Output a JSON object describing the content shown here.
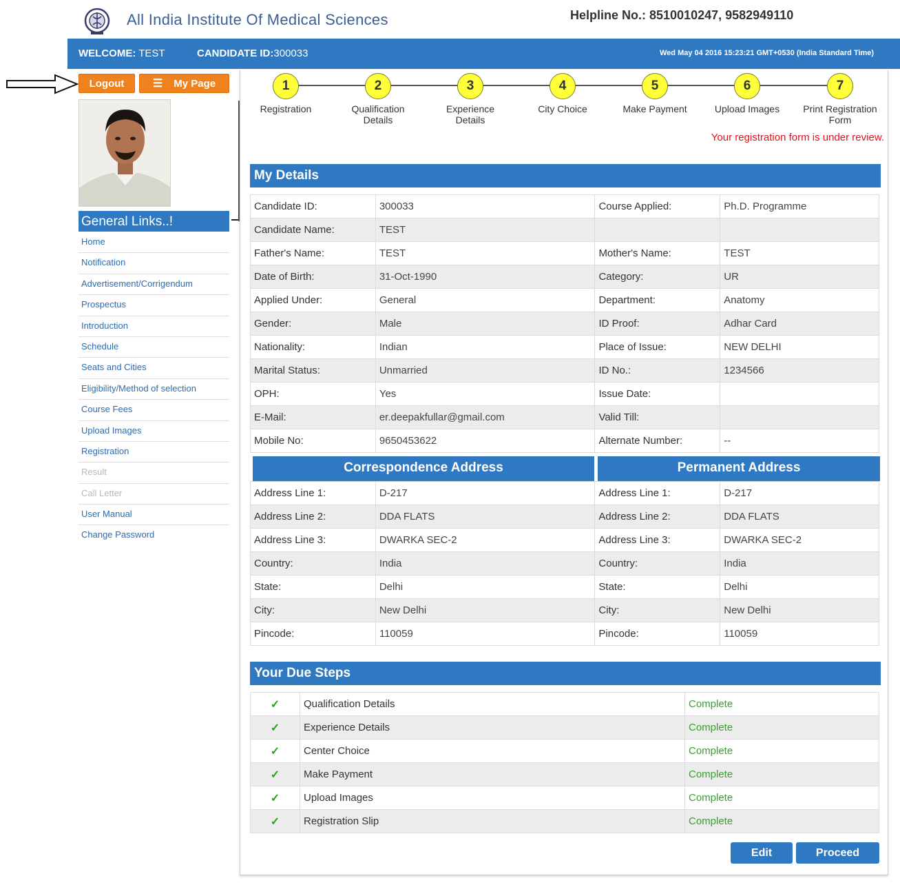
{
  "header": {
    "institute_name": "All India Institute Of Medical Sciences",
    "helpline": "Helpline No.: 8510010247, 9582949110"
  },
  "welcome_bar": {
    "welcome_label": "WELCOME:",
    "welcome_value": "TEST",
    "candidate_label": "CANDIDATE ID:",
    "candidate_value": "300033",
    "datetime": "Wed May 04 2016 15:23:21 GMT+0530 (India Standard Time)"
  },
  "sidebar": {
    "logout_label": "Logout",
    "mypage_label": "My Page",
    "general_links_title": "General Links..!",
    "links": [
      {
        "label": "Home",
        "enabled": true
      },
      {
        "label": "Notification",
        "enabled": true
      },
      {
        "label": "Advertisement/Corrigendum",
        "enabled": true
      },
      {
        "label": "Prospectus",
        "enabled": true
      },
      {
        "label": "Introduction",
        "enabled": true
      },
      {
        "label": "Schedule",
        "enabled": true
      },
      {
        "label": "Seats and Cities",
        "enabled": true
      },
      {
        "label": "Eligibility/Method of selection",
        "enabled": true
      },
      {
        "label": "Course Fees",
        "enabled": true
      },
      {
        "label": "Upload Images",
        "enabled": true
      },
      {
        "label": "Registration",
        "enabled": true
      },
      {
        "label": "Result",
        "enabled": false
      },
      {
        "label": "Call Letter",
        "enabled": false
      },
      {
        "label": "User Manual",
        "enabled": true
      },
      {
        "label": "Change Password",
        "enabled": true
      }
    ]
  },
  "stepper": {
    "steps": [
      {
        "num": "1",
        "label1": "Registration",
        "label2": ""
      },
      {
        "num": "2",
        "label1": "Qualification",
        "label2": "Details"
      },
      {
        "num": "3",
        "label1": "Experience",
        "label2": "Details"
      },
      {
        "num": "4",
        "label1": "City Choice",
        "label2": ""
      },
      {
        "num": "5",
        "label1": "Make Payment",
        "label2": ""
      },
      {
        "num": "6",
        "label1": "Upload Images",
        "label2": ""
      },
      {
        "num": "7",
        "label1": "Print Registration",
        "label2": "Form"
      }
    ],
    "review_notice": "Your registration form is under review."
  },
  "my_details": {
    "title": "My Details",
    "rows": [
      [
        "Candidate ID:",
        "300033",
        "Course Applied:",
        "Ph.D. Programme"
      ],
      [
        "Candidate Name:",
        "TEST",
        "",
        ""
      ],
      [
        "Father's Name:",
        "TEST",
        "Mother's Name:",
        "TEST"
      ],
      [
        "Date of Birth:",
        "31-Oct-1990",
        "Category:",
        "UR"
      ],
      [
        "Applied Under:",
        "General",
        "Department:",
        "Anatomy"
      ],
      [
        "Gender:",
        "Male",
        "ID Proof:",
        "Adhar Card"
      ],
      [
        "Nationality:",
        "Indian",
        "Place of Issue:",
        "NEW DELHI"
      ],
      [
        "Marital Status:",
        "Unmarried",
        "ID No.:",
        "1234566"
      ],
      [
        "OPH:",
        "Yes",
        "Issue Date:",
        ""
      ],
      [
        "E-Mail:",
        "er.deepakfullar@gmail.com",
        "Valid Till:",
        ""
      ],
      [
        "Mobile No:",
        "9650453622",
        "Alternate Number:",
        "--"
      ]
    ]
  },
  "address": {
    "correspondence_title": "Correspondence Address",
    "permanent_title": "Permanent Address",
    "rows": [
      [
        "Address Line 1:",
        "D-217",
        "Address Line 1:",
        "D-217"
      ],
      [
        "Address Line 2:",
        "DDA FLATS",
        "Address Line 2:",
        "DDA FLATS"
      ],
      [
        "Address Line 3:",
        "DWARKA SEC-2",
        "Address Line 3:",
        "DWARKA SEC-2"
      ],
      [
        "Country:",
        "India",
        "Country:",
        "India"
      ],
      [
        "State:",
        "Delhi",
        "State:",
        "Delhi"
      ],
      [
        "City:",
        "New Delhi",
        "City:",
        "New Delhi"
      ],
      [
        "Pincode:",
        "110059",
        "Pincode:",
        "110059"
      ]
    ]
  },
  "due_steps": {
    "title": "Your Due Steps",
    "check_glyph": "✓",
    "items": [
      {
        "name": "Qualification Details",
        "status": "Complete"
      },
      {
        "name": "Experience Details",
        "status": "Complete"
      },
      {
        "name": "Center Choice",
        "status": "Complete"
      },
      {
        "name": "Make Payment",
        "status": "Complete"
      },
      {
        "name": "Upload Images",
        "status": "Complete"
      },
      {
        "name": "Registration Slip",
        "status": "Complete"
      }
    ]
  },
  "actions": {
    "edit_label": "Edit",
    "proceed_label": "Proceed"
  },
  "icons": {
    "logo": "aiims-emblem-icon",
    "arrow": "right-arrow-icon",
    "menu": "list-menu-icon",
    "check": "check-icon"
  },
  "colors": {
    "primary_blue": "#2f79c2",
    "orange": "#f0821e",
    "step_yellow": "#ffff3a",
    "notice_red": "#e8101a",
    "complete_green": "#36a32a"
  }
}
